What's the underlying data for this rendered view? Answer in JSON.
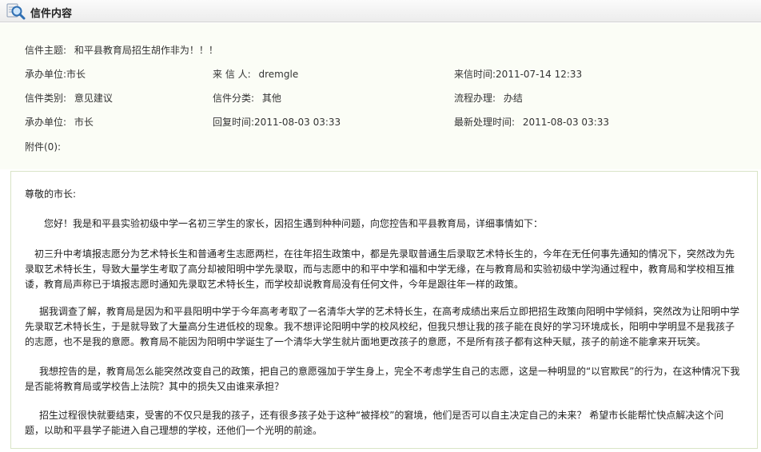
{
  "header": {
    "title": "信件内容"
  },
  "meta": {
    "subject": {
      "label": "信件主题:",
      "value": "和平县教育局招生胡作非为！！！"
    },
    "handler1": {
      "label": "承办单位:",
      "value": "市长"
    },
    "sender": {
      "label": "来 信 人:",
      "value": "dremgle"
    },
    "sent_time": {
      "label": "来信时间:",
      "value": "2011-07-14 12:33"
    },
    "category": {
      "label": "信件类别:",
      "value": "意见建议"
    },
    "classification": {
      "label": "信件分类:",
      "value": "其他"
    },
    "process": {
      "label": "流程办理:",
      "value": "办结"
    },
    "handler2": {
      "label": "承办单位:",
      "value": "市长"
    },
    "reply_time": {
      "label": "回复时间:",
      "value": "2011-08-03 03:33"
    },
    "latest_time": {
      "label": "最新处理时间:",
      "value": "2011-08-03 03:33"
    },
    "attachment": {
      "label": "附件(0):"
    }
  },
  "letter": {
    "salutation": "尊敬的市长:",
    "p1": "您好！我是和平县实验初级中学一名初三学生的家长，因招生遇到种种问题，向您控告和平县教育局，详细事情如下：",
    "p2": "初三升中考填报志愿分为艺术特长生和普通考生志愿两栏，在往年招生政策中，都是先录取普通生后录取艺术特长生的，今年在无任何事先通知的情况下，突然改为先录取艺术特长生，导致大量学生考取了高分却被阳明中学先录取，而与志愿中的和平中学和福和中学无缘，在与教育局和实验初级中学沟通过程中，教育局和学校相互推诿，教育局声称已于填报志愿时通知先录取艺术特长生，而学校却说教育局没有任何文件，今年是跟往年一样的政策。",
    "p3": "据我调查了解，教育局是因为和平县阳明中学于今年高考考取了一名清华大学的艺术特长生，在高考成绩出来后立即把招生政策向阳明中学倾斜，突然改为让阳明中学先录取艺术特长生，于是就导致了大量高分生进低校的现象。我不想评论阳明中学的校风校纪，但我只想让我的孩子能在良好的学习环境成长，阳明中学明显不是我孩子的志愿，也不是我的意愿。教育局不能因为阳明中学诞生了一个清华大学生就片面地更改孩子的意愿，不是所有孩子都有这种天赋，孩子的前途不能拿来开玩笑。",
    "p4": "我想控告的是，教育局怎么能突然改变自己的政策，把自己的意愿强加于学生身上，完全不考虑学生自己的志愿，这是一种明显的“以官欺民”的行为，在这种情况下我是否能将教育局或学校告上法院？其中的损失又由谁来承担？",
    "p5": "招生过程很快就要结束，受害的不仅只是我的孩子，还有很多孩子处于这种“被择校”的窘境，他们是否可以自主决定自己的未来？ 希望市长能帮忙快点解决这个问题，以助和平县学子能进入自己理想的学校，还他们一个光明的前途。"
  }
}
